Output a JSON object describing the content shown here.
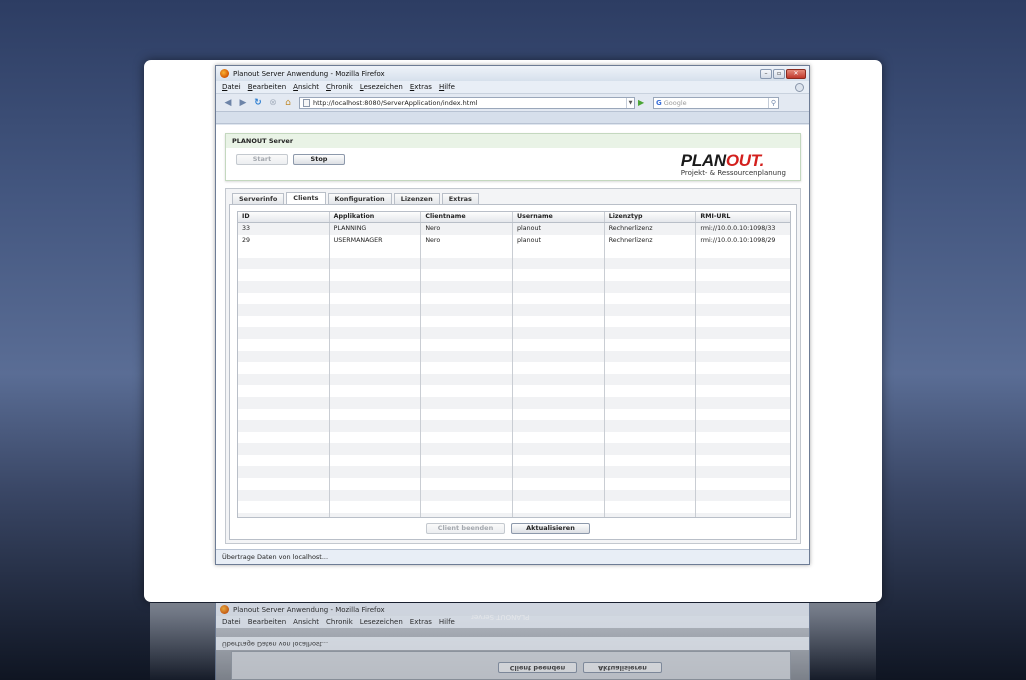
{
  "browser": {
    "title": "Planout Server Anwendung - Mozilla Firefox",
    "menu": [
      "Datei",
      "Bearbeiten",
      "Ansicht",
      "Chronik",
      "Lesezeichen",
      "Extras",
      "Hilfe"
    ],
    "url": "http://localhost:8080/ServerApplication/index.html",
    "search_placeholder": "Google",
    "status": "Übertrage Daten von localhost..."
  },
  "app": {
    "header_title": "PLANOUT Server",
    "start_label": "Start",
    "stop_label": "Stop",
    "logo_text_dark": "PLAN",
    "logo_text_red": "OUT",
    "logo_mark": ".",
    "logo_subtitle": "Projekt- & Ressourcenplanung",
    "tabs": [
      "Serverinfo",
      "Clients",
      "Konfiguration",
      "Lizenzen",
      "Extras"
    ],
    "active_tab": "Clients",
    "columns": [
      "ID",
      "Applikation",
      "Clientname",
      "Username",
      "Lizenztyp",
      "RMI-URL"
    ],
    "rows": [
      [
        "33",
        "PLANNING",
        "Nero",
        "planout",
        "Rechnerlizenz",
        "rmi://10.0.0.10:1098/33"
      ],
      [
        "29",
        "USERMANAGER",
        "Nero",
        "planout",
        "Rechnerlizenz",
        "rmi://10.0.0.10:1098/29"
      ]
    ],
    "client_beenden_label": "Client beenden",
    "aktualisieren_label": "Aktualisieren"
  },
  "reflection": {
    "server_text": "PLANOUT Server"
  },
  "colors": {
    "accent_red": "#d3201d",
    "header_green": "#e9f3e6"
  }
}
